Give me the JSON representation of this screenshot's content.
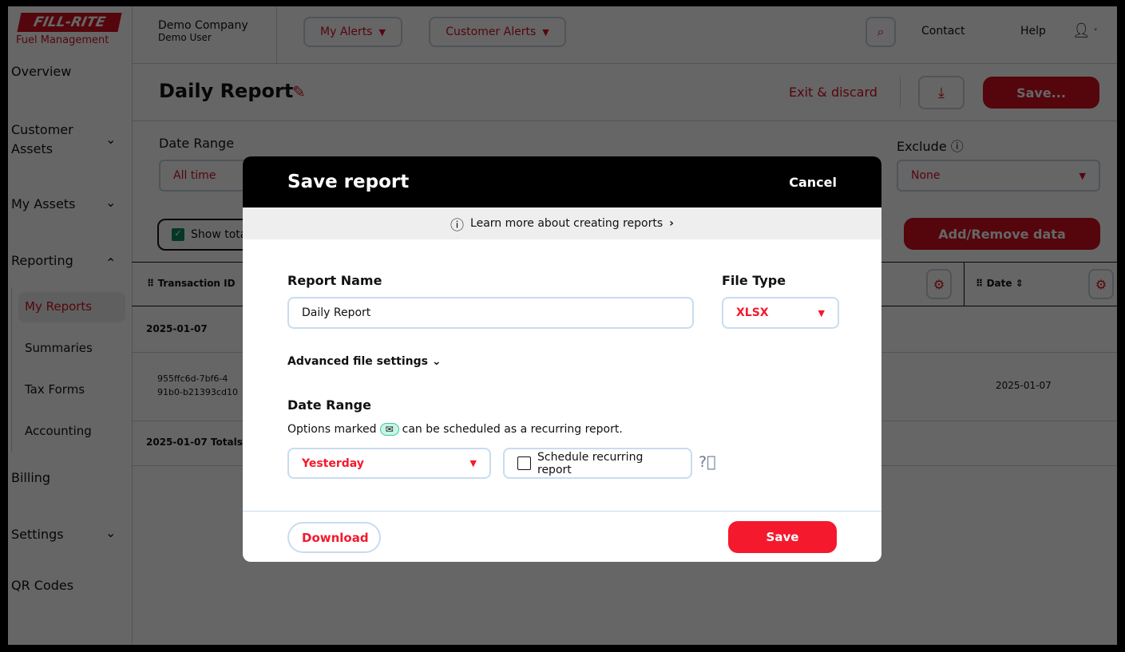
{
  "brand": {
    "logo_text": "FILL-RITE",
    "logo_sub": "Fuel Management"
  },
  "header": {
    "company": "Demo Company",
    "user": "Demo User",
    "my_alerts": "My Alerts",
    "customer_alerts": "Customer Alerts",
    "contact": "Contact",
    "help": "Help"
  },
  "sidebar": {
    "items": [
      {
        "label": "Overview"
      },
      {
        "label": "Customer Assets"
      },
      {
        "label": "My Assets"
      },
      {
        "label": "Reporting"
      },
      {
        "label": "My Reports"
      },
      {
        "label": "Summaries"
      },
      {
        "label": "Tax Forms"
      },
      {
        "label": "Accounting"
      },
      {
        "label": "Billing"
      },
      {
        "label": "Settings"
      },
      {
        "label": "QR Codes"
      }
    ]
  },
  "page": {
    "title": "Daily Report",
    "exit": "Exit & discard",
    "save": "Save...",
    "date_range_label": "Date Range",
    "date_range_value": "All time",
    "exclude_label": "Exclude",
    "exclude_value": "None",
    "show_totals": "Show totals",
    "add_remove": "Add/Remove data"
  },
  "table": {
    "columns": [
      "Transaction ID",
      "Date"
    ],
    "group_date": "2025-01-07",
    "row_id": "955ffc6d-7bf6-4",
    "row_id2": "91b0-b21393cd10",
    "row_date": "2025-01-07",
    "totals": "2025-01-07 Totals:"
  },
  "modal": {
    "title": "Save report",
    "cancel": "Cancel",
    "learn_more": "Learn more about creating reports",
    "report_name_label": "Report Name",
    "report_name_value": "Daily Report",
    "file_type_label": "File Type",
    "file_type_value": "XLSX",
    "advanced": "Advanced file settings",
    "date_range_label": "Date Range",
    "options_pre": "Options marked",
    "options_post": "can be scheduled as a recurring report.",
    "date_range_value": "Yesterday",
    "schedule": "Schedule recurring report",
    "download": "Download",
    "save": "Save"
  },
  "colors": {
    "accent": "#d3101f",
    "modal_save": "#f5192d",
    "checkbox": "#0f8a5f",
    "badge": "#c8f5e4"
  }
}
